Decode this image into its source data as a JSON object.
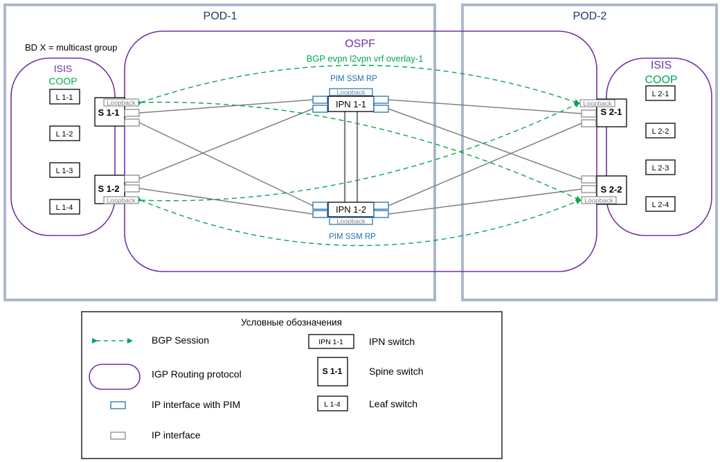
{
  "colors": {
    "pod_border": "#adb7cc",
    "igp": "#7030a0",
    "bgp": "#00a651",
    "pim": "#1f6fb0",
    "link": "#808080",
    "text": "#000000",
    "pod_title": "#1f3864"
  },
  "pods": [
    {
      "id": "pod1",
      "title": "POD-1"
    },
    {
      "id": "pod2",
      "title": "POD-2"
    }
  ],
  "annotations": {
    "bd_note": "BD X = multicast group",
    "ospf": "OSPF",
    "bgp_overlay": "BGP evpn l2vpn vrf overlay-1",
    "pim_rp_top": "PIM SSM RP",
    "pim_rp_bottom": "PIM SSM RP",
    "pod1_isis": "ISIS",
    "pod1_coop": "COOP",
    "pod2_isis": "ISIS",
    "pod2_coop": "COOP"
  },
  "loopback_label": "Loopback",
  "spines": [
    {
      "id": "s11",
      "label": "S 1-1"
    },
    {
      "id": "s12",
      "label": "S 1-2"
    },
    {
      "id": "s21",
      "label": "S 2-1"
    },
    {
      "id": "s22",
      "label": "S 2-2"
    }
  ],
  "ipn": [
    {
      "id": "ipn11",
      "label": "IPN 1-1"
    },
    {
      "id": "ipn12",
      "label": "IPN 1-2"
    }
  ],
  "leafs_pod1": [
    "L 1-1",
    "L 1-2",
    "L 1-3",
    "L 1-4"
  ],
  "leafs_pod2": [
    "L 2-1",
    "L 2-2",
    "L 2-3",
    "L 2-4"
  ],
  "links": [
    [
      "s11",
      "ipn11"
    ],
    [
      "s11",
      "ipn12"
    ],
    [
      "s12",
      "ipn11"
    ],
    [
      "s12",
      "ipn12"
    ],
    [
      "s21",
      "ipn11"
    ],
    [
      "s21",
      "ipn12"
    ],
    [
      "s22",
      "ipn11"
    ],
    [
      "s22",
      "ipn12"
    ],
    [
      "ipn11",
      "ipn12"
    ],
    [
      "ipn11",
      "ipn12"
    ]
  ],
  "bgp_sessions": [
    [
      "s11",
      "s21"
    ],
    [
      "s11",
      "s22"
    ],
    [
      "s12",
      "s21"
    ],
    [
      "s12",
      "s22"
    ]
  ],
  "legend": {
    "title": "Условные обозначения",
    "items": [
      {
        "symbol": "bgp-arrow",
        "label": "BGP Session"
      },
      {
        "symbol": "igp-oval",
        "label": "IGP Routing protocol"
      },
      {
        "symbol": "pim-interface",
        "label": "IP interface with PIM"
      },
      {
        "symbol": "ip-interface",
        "label": "IP interface"
      },
      {
        "symbol": "ipn-box",
        "sample": "IPN 1-1",
        "label": "IPN switch"
      },
      {
        "symbol": "spine-box",
        "sample": "S 1-1",
        "label": "Spine switch"
      },
      {
        "symbol": "leaf-box",
        "sample": "L 1-4",
        "label": "Leaf switch"
      }
    ]
  }
}
